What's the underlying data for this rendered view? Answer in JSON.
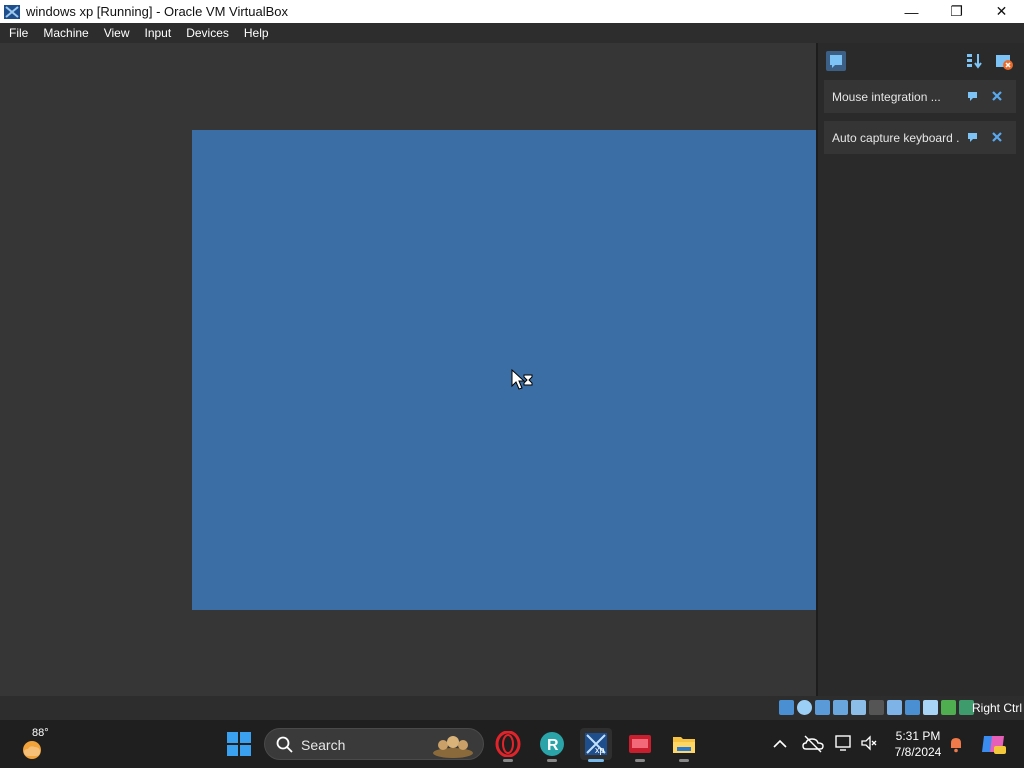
{
  "window": {
    "title": "windows xp [Running] - Oracle VM VirtualBox",
    "minimize_glyph": "—",
    "maximize_glyph": "❐",
    "close_glyph": "✕"
  },
  "menu": {
    "items": [
      "File",
      "Machine",
      "View",
      "Input",
      "Devices",
      "Help"
    ]
  },
  "guest": {
    "background_color": "#3b6ea5",
    "cursor": "busy-cursor-icon"
  },
  "notifications": {
    "items": [
      {
        "label": "Mouse integration ..."
      },
      {
        "label": "Auto capture keyboard ..."
      }
    ]
  },
  "statusbar": {
    "host_key": "Right Ctrl",
    "device_icons": [
      "hard-disk-icon",
      "optical-drive-icon",
      "audio-icon",
      "network-icon",
      "usb-icon",
      "shared-folders-icon",
      "display-icon",
      "video-capture-icon",
      "vram-icon",
      "cpu-icon",
      "mouse-integration-icon",
      "keyboard-icon"
    ]
  },
  "taskbar": {
    "weather_temp": "88°",
    "search_placeholder": "Search",
    "apps": [
      "opera-icon",
      "app-r-icon",
      "virtualbox-icon",
      "video-editor-icon",
      "file-explorer-icon"
    ],
    "clock_time": "5:31 PM",
    "clock_date": "7/8/2024"
  }
}
